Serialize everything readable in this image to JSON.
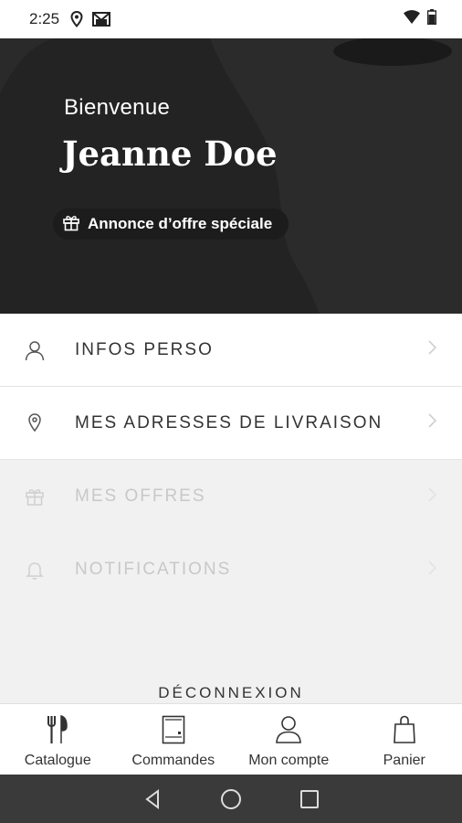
{
  "status_bar": {
    "time": "2:25",
    "icons": [
      "location-icon",
      "gmail-icon",
      "wifi-icon",
      "battery-icon"
    ]
  },
  "hero": {
    "greeting": "Bienvenue",
    "name": "Jeanne Doe",
    "offer_chip": {
      "icon": "gift-icon",
      "label": "Annonce d’offre spéciale"
    },
    "background_color": "#232323"
  },
  "menu": {
    "items": [
      {
        "icon": "user-icon",
        "label": "INFOS PERSO",
        "state": "enabled"
      },
      {
        "icon": "location-pin-icon",
        "label": "MES ADRESSES DE LIVRAISON",
        "state": "enabled"
      },
      {
        "icon": "gift-icon",
        "label": "MES OFFRES",
        "state": "disabled"
      },
      {
        "icon": "bell-icon",
        "label": "NOTIFICATIONS",
        "state": "disabled"
      }
    ]
  },
  "logout": {
    "label": "DÉCONNEXION"
  },
  "bottom_nav": {
    "items": [
      {
        "icon": "fork-knife-icon",
        "label": "Catalogue"
      },
      {
        "icon": "receipt-icon",
        "label": "Commandes"
      },
      {
        "icon": "account-icon",
        "label": "Mon compte"
      },
      {
        "icon": "shopping-bag-icon",
        "label": "Panier"
      }
    ]
  },
  "system_nav": {
    "buttons": [
      "back-icon",
      "home-icon",
      "recents-icon"
    ]
  }
}
